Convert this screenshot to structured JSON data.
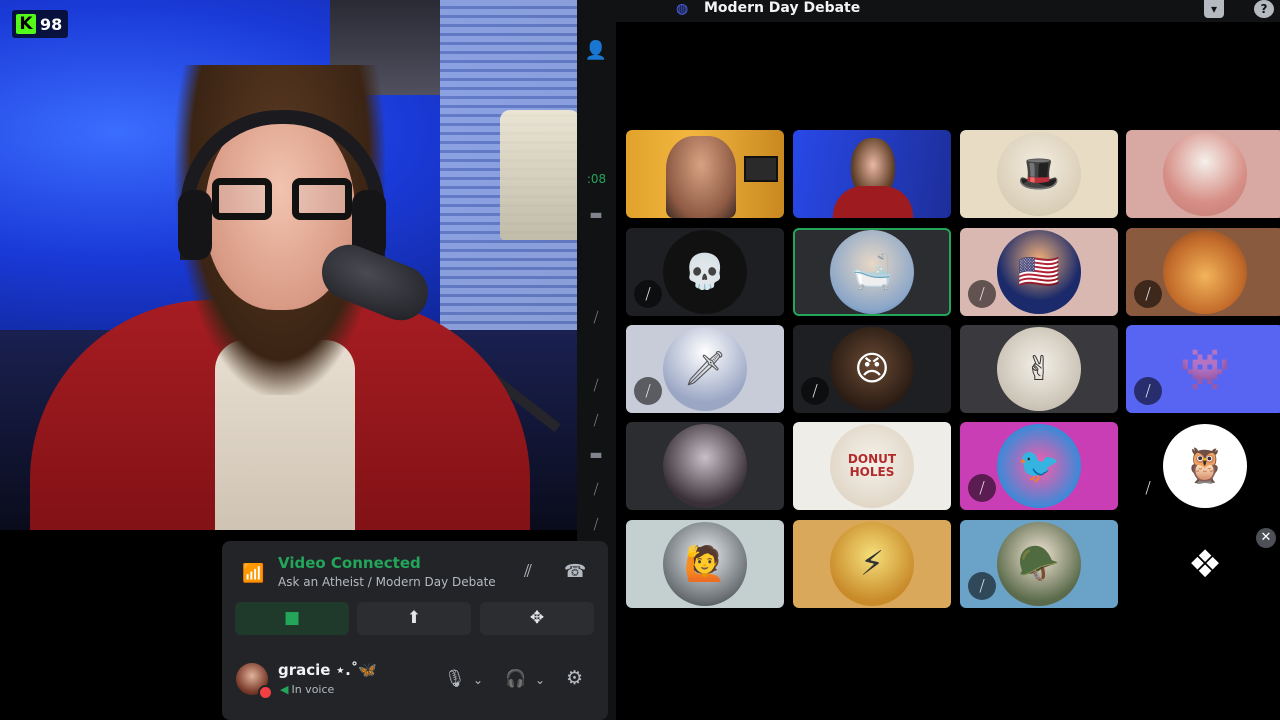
{
  "stream": {
    "viewer_count": "98",
    "platform_logo": "K"
  },
  "topbar": {
    "channel_title": "Modern Day Debate",
    "channel_icon": "stage-icon",
    "inbox_icon": "inbox-icon",
    "help_icon": "?"
  },
  "sidebar": {
    "time_fragment": ":08"
  },
  "tiles": [
    {
      "name": "tile-video-man",
      "type": "video",
      "muted": false,
      "speaking": false
    },
    {
      "name": "tile-video-gracie",
      "type": "video",
      "muted": false,
      "speaking": false
    },
    {
      "name": "tile-avatar-portrait",
      "type": "avatar",
      "muted": false,
      "speaking": false
    },
    {
      "name": "tile-avatar-pink",
      "type": "avatar",
      "muted": false,
      "speaking": false
    },
    {
      "name": "tile-avatar-skull",
      "type": "avatar",
      "muted": true,
      "speaking": false
    },
    {
      "name": "tile-avatar-bathtub",
      "type": "avatar",
      "muted": false,
      "speaking": true
    },
    {
      "name": "tile-avatar-politician",
      "type": "avatar",
      "muted": true,
      "speaking": false
    },
    {
      "name": "tile-avatar-cartoon",
      "type": "avatar",
      "muted": true,
      "speaking": false
    },
    {
      "name": "tile-avatar-angel",
      "type": "avatar",
      "muted": true,
      "speaking": false
    },
    {
      "name": "tile-avatar-shouting",
      "type": "avatar",
      "muted": true,
      "speaking": false
    },
    {
      "name": "tile-avatar-sketch",
      "type": "avatar",
      "muted": false,
      "speaking": false
    },
    {
      "name": "tile-avatar-discord",
      "type": "avatar",
      "muted": true,
      "speaking": false
    },
    {
      "name": "tile-avatar-anime",
      "type": "avatar",
      "muted": false,
      "speaking": false
    },
    {
      "name": "tile-avatar-donut",
      "type": "avatar",
      "muted": false,
      "speaking": false,
      "text": "DONUT HOLES"
    },
    {
      "name": "tile-avatar-pink-bird",
      "type": "avatar",
      "muted": true,
      "speaking": false
    },
    {
      "name": "tile-avatar-silhouette",
      "type": "avatar",
      "muted": true,
      "speaking": false
    },
    {
      "name": "tile-avatar-hooded",
      "type": "avatar",
      "muted": false,
      "speaking": false
    },
    {
      "name": "tile-avatar-saiyan",
      "type": "avatar",
      "muted": false,
      "speaking": false
    },
    {
      "name": "tile-avatar-soldier",
      "type": "avatar",
      "muted": true,
      "speaking": false
    },
    {
      "name": "tile-activity",
      "type": "activity",
      "muted": false,
      "speaking": false
    }
  ],
  "voice_panel": {
    "status": "Video Connected",
    "channel": "Ask an Atheist / Modern Day Debate"
  },
  "user_panel": {
    "username": "gracie ⋆.˚🦋",
    "status": "In voice"
  },
  "colors": {
    "accent_green": "#23a55a",
    "discord_blurple": "#5865f2",
    "kick_green": "#53fc18"
  }
}
